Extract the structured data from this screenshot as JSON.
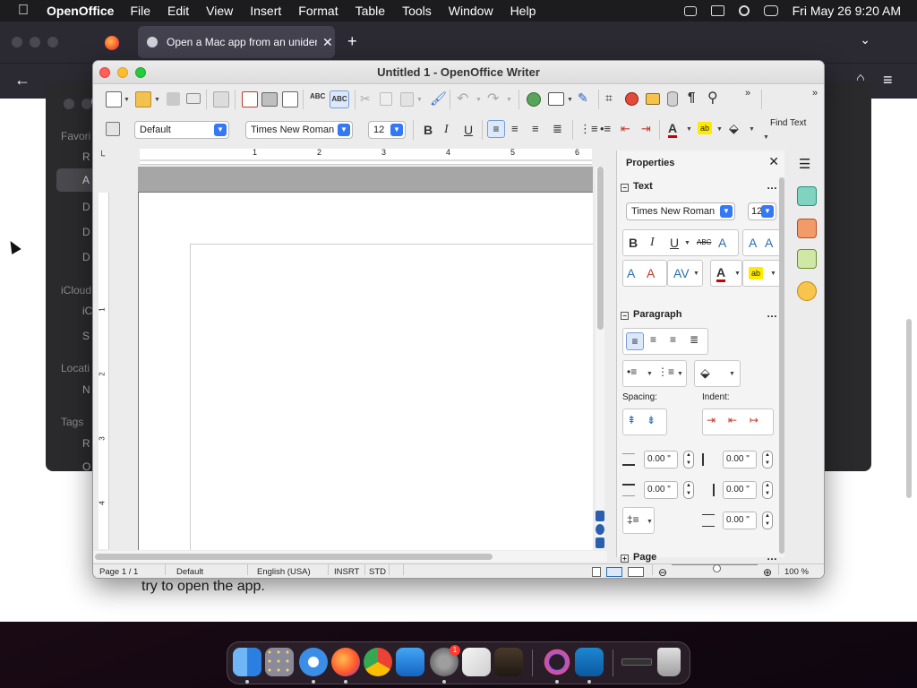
{
  "menubar": {
    "app_name": "OpenOffice",
    "items": [
      "File",
      "Edit",
      "View",
      "Insert",
      "Format",
      "Table",
      "Tools",
      "Window",
      "Help"
    ],
    "clock": "Fri May 26  9:20 AM"
  },
  "browser": {
    "tab_title": "Open a Mac app from an uniden",
    "page_text": "try to open the app.",
    "page_text_2": "",
    "finder_labels": [
      "Favori",
      "iCloud",
      "Locati",
      "Tags"
    ],
    "finder_items": [
      "R",
      "A",
      "D",
      "D",
      "D",
      "iC",
      "S",
      "N",
      "R",
      "O"
    ]
  },
  "writer": {
    "title": "Untitled 1 - OpenOffice Writer",
    "find_text": "Find Text",
    "style_value": "Default",
    "font_value": "Times New Roman",
    "size_value": "12",
    "ruler_numbers": [
      "1",
      "2",
      "3",
      "4",
      "5",
      "6"
    ],
    "vruler_numbers": [
      "1",
      "2",
      "3",
      "4"
    ]
  },
  "properties": {
    "title": "Properties",
    "text_section": "Text",
    "font_value": "Times New Roman",
    "size_value": "12",
    "paragraph_section": "Paragraph",
    "spacing_label": "Spacing:",
    "indent_label": "Indent:",
    "above_spacing": "0.00 \"",
    "below_spacing": "0.00 \"",
    "before_indent": "0.00 \"",
    "after_indent": "0.00 \"",
    "first_line_indent": "0.00 \"",
    "page_section": "Page"
  },
  "statusbar": {
    "page": "Page 1 / 1",
    "style": "Default",
    "language": "English (USA)",
    "insert_mode": "INSRT",
    "selection_mode": "STD",
    "zoom": "100 %"
  },
  "dock": {
    "settings_badge": "1"
  },
  "colors": {
    "accent": "#3478f6",
    "menubar": "#1c1c1e",
    "close": "#ff5f57",
    "minimize": "#febc2e",
    "maximize": "#28c840"
  }
}
